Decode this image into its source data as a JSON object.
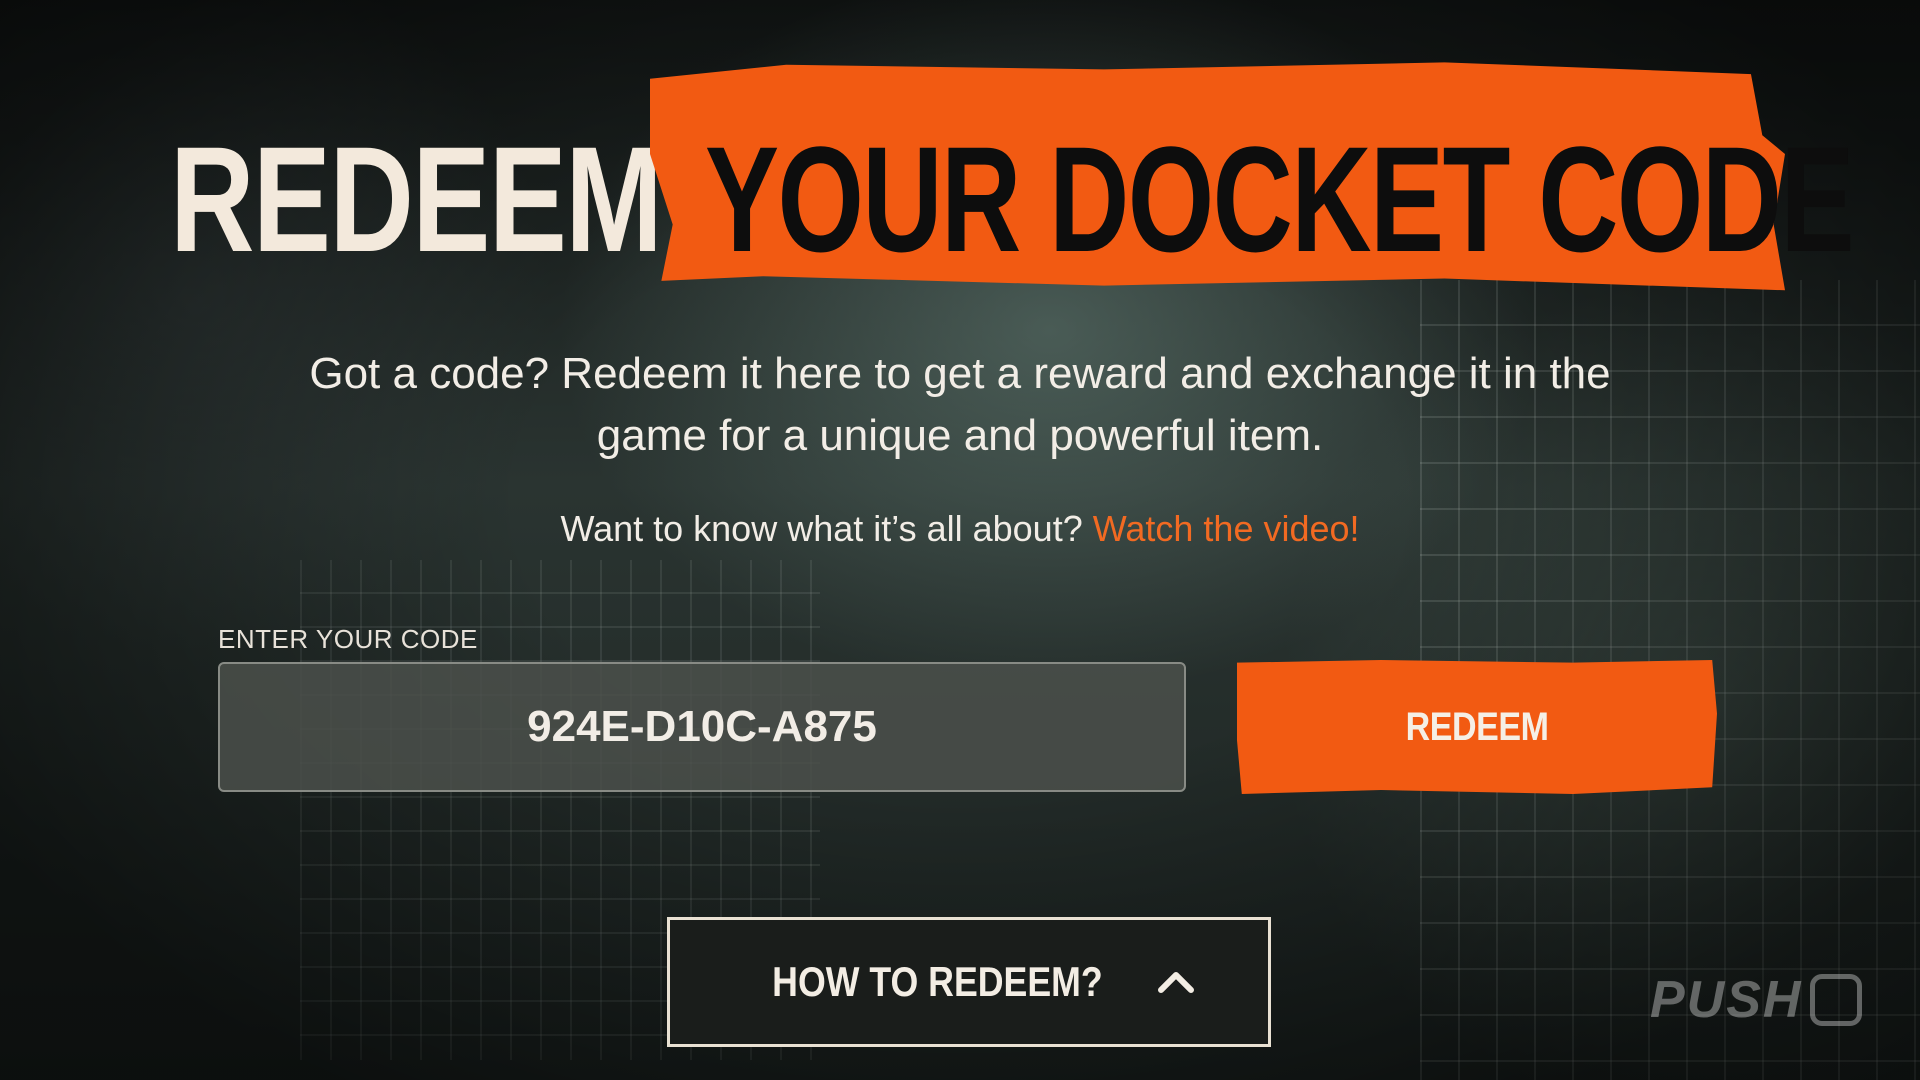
{
  "header": {
    "title_part1": "REDEEM",
    "title_part2": "YOUR DOCKET CODE"
  },
  "description": "Got a code? Redeem it here to get a reward and exchange it in the game for a unique and powerful item.",
  "video_prompt": {
    "text": "Want to know what it’s all about?",
    "link_label": "Watch the video!"
  },
  "code_form": {
    "label": "ENTER YOUR CODE",
    "value": "924E-D10C-A875",
    "submit_label": "REDEEM"
  },
  "how_to": {
    "label": "HOW TO REDEEM?",
    "icon": "chevron-up-icon"
  },
  "watermark": {
    "text": "PUSH"
  },
  "colors": {
    "accent": "#f25a12",
    "link": "#f26a22",
    "text": "#f2ede6"
  }
}
